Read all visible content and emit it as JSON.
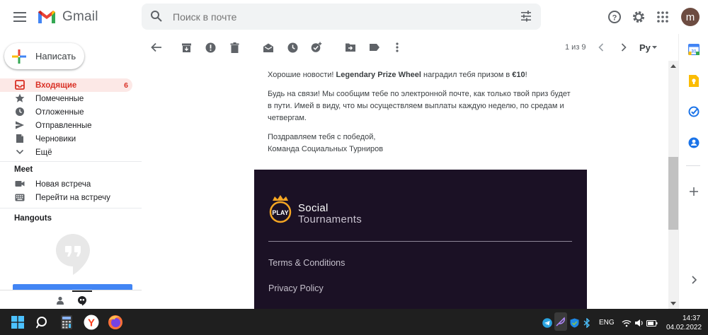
{
  "header": {
    "app_name": "Gmail",
    "search_placeholder": "Поиск в почте",
    "avatar_letter": "m"
  },
  "sidebar": {
    "compose_label": "Написать",
    "items": [
      {
        "label": "Входящие",
        "count": "6",
        "icon": "inbox-icon",
        "active": true
      },
      {
        "label": "Помеченные",
        "icon": "star-icon"
      },
      {
        "label": "Отложенные",
        "icon": "clock-icon"
      },
      {
        "label": "Отправленные",
        "icon": "send-icon"
      },
      {
        "label": "Черновики",
        "icon": "draft-icon"
      },
      {
        "label": "Ещё",
        "icon": "chevron-down-icon"
      }
    ],
    "meet": {
      "title": "Meet",
      "items": [
        {
          "label": "Новая встреча",
          "icon": "videocam-icon"
        },
        {
          "label": "Перейти на встречу",
          "icon": "keyboard-icon"
        }
      ]
    },
    "hangouts_title": "Hangouts"
  },
  "toolbar": {
    "pager": "1 из 9",
    "language": "Ру"
  },
  "mail": {
    "p1_pre": "Хорошие новости! ",
    "p1_bold1": "Legendary Prize Wheel",
    "p1_mid": " наградил тебя призом в ",
    "p1_bold2": "€10",
    "p1_post": "!",
    "p2": "Будь на связи! Мы сообщим тебе по электронной почте, как только твой приз будет в пути. Имей в виду, что мы осуществляем выплаты каждую неделю, по средам и четвергам.",
    "p3_line1": "Поздравляем тебя с победой,",
    "p3_line2": "Команда Социальных Турниров",
    "footer": {
      "logo_text": "PLAY",
      "brand_line1": "Social",
      "brand_line2": "Tournaments",
      "links": [
        "Terms & Conditions",
        "Privacy Policy"
      ]
    }
  },
  "taskbar": {
    "lang": "ENG",
    "time": "14:37",
    "date": "04.02.2022"
  },
  "colors": {
    "accent_red": "#d93025",
    "active_bg": "#fce8e6",
    "footer_bg": "#1b1125"
  }
}
